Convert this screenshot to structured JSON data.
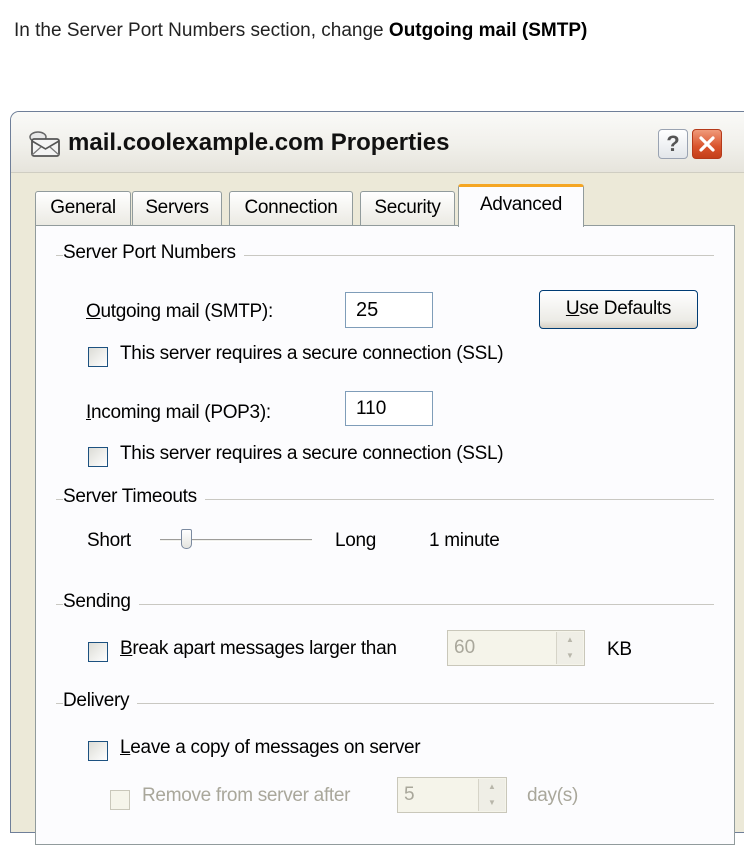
{
  "instruction": {
    "prefix": "In the Server Port Numbers section, change ",
    "bold": "Outgoing mail (SMTP)"
  },
  "dialog": {
    "title": "mail.coolexample.com Properties",
    "help_label": "?",
    "tabs": [
      {
        "label": "General",
        "active": false
      },
      {
        "label": "Servers",
        "active": false
      },
      {
        "label": "Connection",
        "active": false
      },
      {
        "label": "Security",
        "active": false
      },
      {
        "label": "Advanced",
        "active": true
      }
    ]
  },
  "server_ports": {
    "section_title": "Server Port Numbers",
    "outgoing_label": "Outgoing mail (SMTP):",
    "outgoing_value": "25",
    "use_defaults_label": "Use Defaults",
    "outgoing_ssl_label": "This server requires a secure connection (SSL)",
    "outgoing_ssl_checked": false,
    "incoming_label": "Incoming mail (POP3):",
    "incoming_value": "110",
    "incoming_ssl_label": "This server requires a secure connection (SSL)",
    "incoming_ssl_checked": false
  },
  "server_timeouts": {
    "section_title": "Server Timeouts",
    "short_label": "Short",
    "long_label": "Long",
    "value_text": "1 minute",
    "slider_level": 0.15
  },
  "sending": {
    "section_title": "Sending",
    "break_apart_label": "Break apart messages larger than",
    "break_apart_checked": false,
    "size_value": "60",
    "unit_label": "KB"
  },
  "delivery": {
    "section_title": "Delivery",
    "leave_copy_label": "Leave a copy of messages on server",
    "leave_copy_checked": false,
    "remove_label": "Remove from server after",
    "remove_days": "5",
    "days_label": "day(s)"
  },
  "colors": {
    "tab_accent": "#f5a623",
    "close_button": "#d9532c",
    "dialog_face": "#ece9d8"
  }
}
